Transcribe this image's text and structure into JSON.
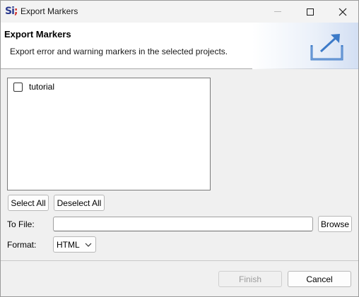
{
  "window": {
    "title": "Export Markers",
    "logo_text": "Si",
    "logo_dot": ";"
  },
  "banner": {
    "title": "Export Markers",
    "description": "Export error and warning markers in the selected projects."
  },
  "project_list": {
    "items": [
      {
        "label": "tutorial",
        "checked": false
      }
    ]
  },
  "buttons": {
    "select_all": "Select All",
    "deselect_all": "Deselect All",
    "browse": "Browse",
    "finish": "Finish",
    "cancel": "Cancel"
  },
  "form": {
    "to_file_label": "To File:",
    "to_file_value": "",
    "format_label": "Format:",
    "format_value": "HTML"
  },
  "colors": {
    "logo_blue": "#2b3a8f",
    "logo_red": "#d0312d",
    "banner_icon_blue": "#3c7ac8"
  }
}
